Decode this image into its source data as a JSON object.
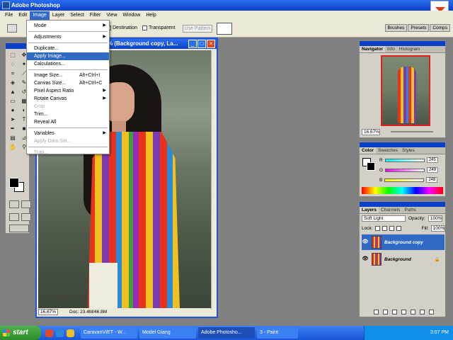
{
  "app": {
    "title": "Adobe Photoshop"
  },
  "menubar": [
    "File",
    "Edit",
    "Image",
    "Layer",
    "Select",
    "Filter",
    "View",
    "Window",
    "Help"
  ],
  "options": {
    "destination": "Destination",
    "transparent": "Transparent",
    "use_pattern": "Use Pattern"
  },
  "palette_well": [
    "Brushes",
    "Presets",
    "Comps"
  ],
  "image_menu": {
    "mode": "Mode",
    "adjustments": "Adjustments",
    "duplicate": "Duplicate...",
    "apply_image": "Apply Image...",
    "calculations": "Calculations...",
    "image_size": "Image Size...",
    "image_size_sc": "Alt+Ctrl+I",
    "canvas_size": "Canvas Size...",
    "canvas_size_sc": "Alt+Ctrl+C",
    "pixel_aspect": "Pixel Aspect Ratio",
    "rotate_canvas": "Rotate Canvas",
    "crop": "Crop",
    "trim": "Trim...",
    "reveal_all": "Reveal All",
    "variables": "Variables",
    "apply_data_set": "Apply Data Set...",
    "trap": "Trap..."
  },
  "document": {
    "title": "% (Background copy, La...",
    "zoom": "16.67%",
    "doc_info": "Doc: 23.4M/46.8M"
  },
  "navigator": {
    "tabs": [
      "Navigator",
      "Info",
      "Histogram"
    ],
    "zoom": "16.67%"
  },
  "color": {
    "tabs": [
      "Color",
      "Swatches",
      "Styles"
    ],
    "channels": [
      {
        "label": "R",
        "value": "245"
      },
      {
        "label": "G",
        "value": "249"
      },
      {
        "label": "B",
        "value": "248"
      }
    ]
  },
  "layers": {
    "tabs": [
      "Layers",
      "Channels",
      "Paths"
    ],
    "blend_mode": "Soft Light",
    "opacity_label": "Opacity:",
    "opacity": "100%",
    "lock_label": "Lock:",
    "fill_label": "Fill:",
    "fill": "100%",
    "items": [
      {
        "name": "Background copy"
      },
      {
        "name": "Background"
      }
    ]
  },
  "taskbar": {
    "start": "start",
    "tasks": [
      "CaravanVIET - W...",
      "Model Giang",
      "Adobe Photosho...",
      "3 - Paint"
    ],
    "clock": "3:07 PM"
  }
}
